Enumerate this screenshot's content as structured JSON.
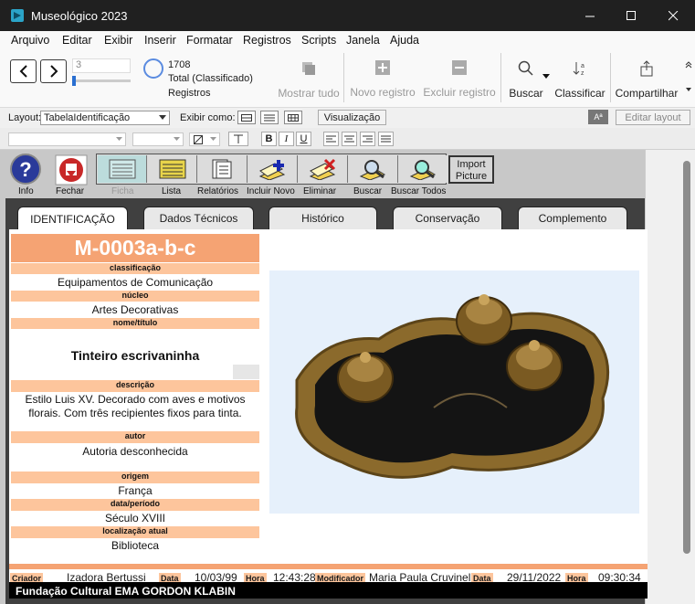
{
  "window": {
    "title": "Museológico 2023"
  },
  "menu": [
    "Arquivo",
    "Editar",
    "Exibir",
    "Inserir",
    "Formatar",
    "Registros",
    "Scripts",
    "Janela",
    "Ajuda"
  ],
  "toolbar": {
    "record_number": "3",
    "record_count": "1708",
    "total_label": "Total (Classificado)",
    "records_label": "Registros",
    "show_all": "Mostrar tudo",
    "new_record": "Novo registro",
    "delete_record": "Excluir registro",
    "find": "Buscar",
    "sort": "Classificar",
    "share": "Compartilhar"
  },
  "layoutbar": {
    "layout_label": "Layout:",
    "layout_value": "TabelaIdentificação",
    "view_as": "Exibir como:",
    "preview": "Visualização",
    "aa": "Aª",
    "edit_layout": "Editar layout"
  },
  "icons": {
    "info": "Info",
    "close": "Fechar",
    "ficha": "Ficha",
    "lista": "Lista",
    "relatorios": "Relatórios",
    "incluir": "Incluir Novo",
    "eliminar": "Eliminar",
    "buscar": "Buscar",
    "buscar_todos": "Buscar Todos",
    "import": "Import Picture"
  },
  "tabs": [
    "IDENTIFICAÇÃO",
    "Dados Técnicos",
    "Histórico",
    "Conservação",
    "Complemento"
  ],
  "record": {
    "id": "M-0003a-b-c",
    "classificacao_label": "classificação",
    "classificacao": "Equipamentos de Comunicação",
    "nucleo_label": "núcleo",
    "nucleo": "Artes Decorativas",
    "nome_label": "nome/título",
    "nome": "Tinteiro escrivaninha",
    "descricao_label": "descrição",
    "descricao": "Estilo Luis XV. Decorado com aves e motivos florais. Com três recipientes fixos para tinta.",
    "autor_label": "autor",
    "autor": "Autoria desconhecida",
    "origem_label": "origem",
    "origem": "França",
    "data_label": "data/período",
    "data": "Século XVIII",
    "local_label": "localização atual",
    "local": "Biblioteca"
  },
  "footer": {
    "criador_label": "Criador",
    "criador": "Izadora Bertussi",
    "data_label": "Data",
    "data_criacao": "10/03/99",
    "hora_label": "Hora",
    "hora_criacao": "12:43:28",
    "modificador_label": "Modificador",
    "modificador": "Maria Paula Cruvinel",
    "data_mod": "29/11/2022",
    "hora_mod": "09:30:34"
  },
  "bottom": "Fundação Cultural EMA GORDON KLABIN",
  "colors": {
    "accent_orange": "#f5a373",
    "label_orange": "#fdc59c",
    "image_bg": "#e6f0fb"
  }
}
